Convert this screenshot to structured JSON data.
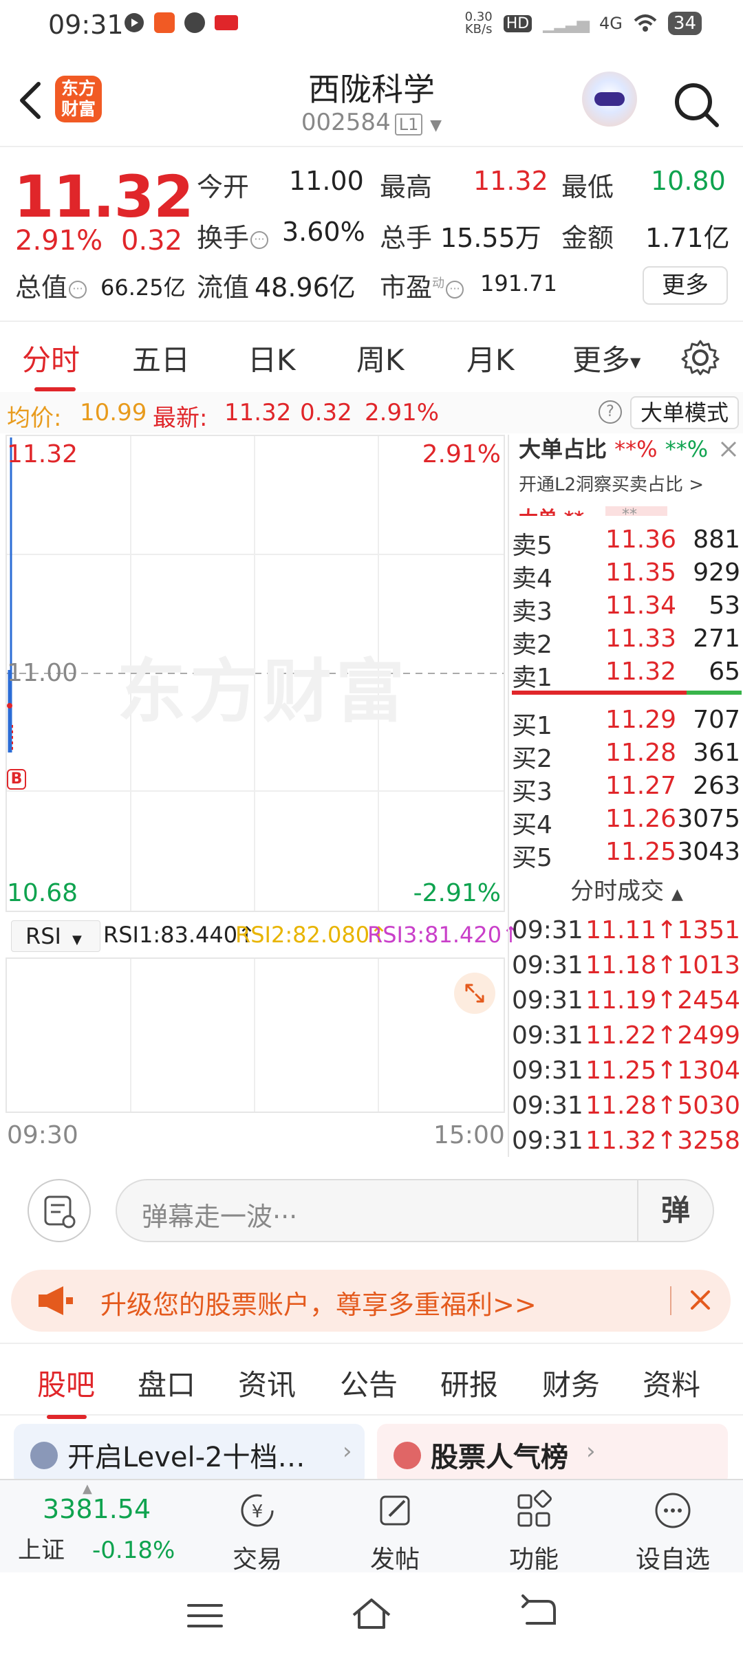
{
  "status": {
    "time": "09:31",
    "net_speed": "0.30\nKB/s",
    "battery": "34",
    "signal": "4G",
    "toutiao": "头条",
    "hd": "HD"
  },
  "header": {
    "title": "西陇科学",
    "code": "002584",
    "level": "L1",
    "logo_text": "东方财富"
  },
  "quote": {
    "price": "11.32",
    "pct": "2.91%",
    "chg": "0.32",
    "rows": [
      [
        {
          "label": "今开",
          "value": "11.00",
          "color": "dark"
        },
        {
          "label": "最高",
          "value": "11.32",
          "color": "red"
        },
        {
          "label": "最低",
          "value": "10.80",
          "color": "green"
        }
      ],
      [
        {
          "label": "换手",
          "value": "3.60%",
          "color": "dark"
        },
        {
          "label": "总手",
          "value": "15.55万",
          "color": "dark"
        },
        {
          "label": "金额",
          "value": "1.71亿",
          "color": "dark"
        }
      ],
      [
        {
          "label": "总值",
          "value": "66.25亿",
          "color": "dark"
        },
        {
          "label": "流值",
          "value": "48.96亿",
          "color": "dark"
        },
        {
          "label": "市盈",
          "value": "191.71",
          "color": "dark"
        }
      ]
    ],
    "pe_sup": "动",
    "more": "更多"
  },
  "tabs": [
    "分时",
    "五日",
    "日K",
    "周K",
    "月K",
    "更多"
  ],
  "infobar": {
    "avg_label": "均价:",
    "avg": "10.99",
    "new_label": "最新:",
    "new": "11.32",
    "chg": "0.32",
    "pct": "2.91%",
    "q": "?",
    "mode": "大单模式"
  },
  "chart": {
    "top_price": "11.32",
    "top_pct": "2.91%",
    "mid_price": "11.00",
    "bottom_price": "10.68",
    "bottom_pct": "-2.91%",
    "watermark": "东方财富",
    "b_marker": "B",
    "time_start": "09:30",
    "time_end": "15:00"
  },
  "rsi": {
    "selector": "RSI",
    "rsi1": "RSI1:83.440↑",
    "rsi2": "RSI2:82.080↑",
    "rsi3": "RSI3:81.420↑"
  },
  "ratio": {
    "title": "大单占比",
    "r1": "**%",
    "r2": "**%",
    "l2_text": "开通L2洞察买卖占比 >",
    "big": "大单",
    "stars": "**"
  },
  "sells": [
    {
      "name": "卖5",
      "price": "11.36",
      "vol": "881"
    },
    {
      "name": "卖4",
      "price": "11.35",
      "vol": "929"
    },
    {
      "name": "卖3",
      "price": "11.34",
      "vol": "53"
    },
    {
      "name": "卖2",
      "price": "11.33",
      "vol": "271"
    },
    {
      "name": "卖1",
      "price": "11.32",
      "vol": "65"
    }
  ],
  "buys": [
    {
      "name": "买1",
      "price": "11.29",
      "vol": "707"
    },
    {
      "name": "买2",
      "price": "11.28",
      "vol": "361"
    },
    {
      "name": "买3",
      "price": "11.27",
      "vol": "263"
    },
    {
      "name": "买4",
      "price": "11.26",
      "vol": "3075"
    },
    {
      "name": "买5",
      "price": "11.25",
      "vol": "3043"
    }
  ],
  "trades_title": "分时成交",
  "trades": [
    {
      "time": "09:31",
      "val": "11.11↑1351"
    },
    {
      "time": "09:31",
      "val": "11.18↑1013"
    },
    {
      "time": "09:31",
      "val": "11.19↑2454"
    },
    {
      "time": "09:31",
      "val": "11.22↑2499"
    },
    {
      "time": "09:31",
      "val": "11.25↑1304"
    },
    {
      "time": "09:31",
      "val": "11.28↑5030"
    },
    {
      "time": "09:31",
      "val": "11.32↑3258"
    }
  ],
  "comment": {
    "placeholder": "弹幕走一波···",
    "dan": "弹"
  },
  "promo": {
    "text": "升级您的股票账户，尊享多重福利>>"
  },
  "subtabs": [
    "股吧",
    "盘口",
    "资讯",
    "公告",
    "研报",
    "财务",
    "资料"
  ],
  "cards": [
    {
      "text": "开启Level-2十档…"
    },
    {
      "text": "股票人气榜"
    }
  ],
  "bottom": {
    "index_value": "3381.54",
    "index_name": "上证",
    "index_chg": "-0.18%",
    "items": [
      "交易",
      "发帖",
      "功能",
      "设自选"
    ]
  },
  "colors": {
    "red": "#e0262a",
    "green": "#0fa34f",
    "orange": "#f15a24"
  }
}
